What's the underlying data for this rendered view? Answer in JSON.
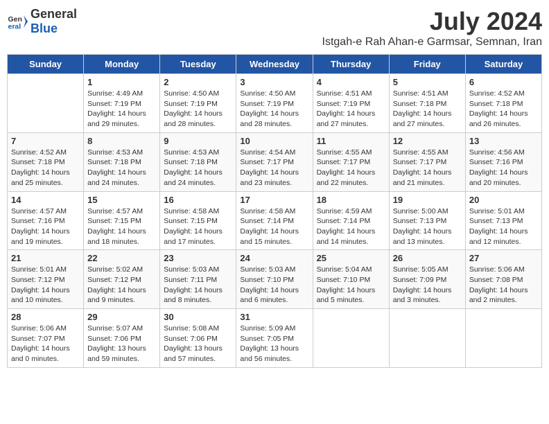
{
  "header": {
    "logo_general": "General",
    "logo_blue": "Blue",
    "month_year": "July 2024",
    "location": "Istgah-e Rah Ahan-e Garmsar, Semnan, Iran"
  },
  "weekdays": [
    "Sunday",
    "Monday",
    "Tuesday",
    "Wednesday",
    "Thursday",
    "Friday",
    "Saturday"
  ],
  "weeks": [
    [
      {
        "day": "",
        "info": ""
      },
      {
        "day": "1",
        "info": "Sunrise: 4:49 AM\nSunset: 7:19 PM\nDaylight: 14 hours\nand 29 minutes."
      },
      {
        "day": "2",
        "info": "Sunrise: 4:50 AM\nSunset: 7:19 PM\nDaylight: 14 hours\nand 28 minutes."
      },
      {
        "day": "3",
        "info": "Sunrise: 4:50 AM\nSunset: 7:19 PM\nDaylight: 14 hours\nand 28 minutes."
      },
      {
        "day": "4",
        "info": "Sunrise: 4:51 AM\nSunset: 7:19 PM\nDaylight: 14 hours\nand 27 minutes."
      },
      {
        "day": "5",
        "info": "Sunrise: 4:51 AM\nSunset: 7:18 PM\nDaylight: 14 hours\nand 27 minutes."
      },
      {
        "day": "6",
        "info": "Sunrise: 4:52 AM\nSunset: 7:18 PM\nDaylight: 14 hours\nand 26 minutes."
      }
    ],
    [
      {
        "day": "7",
        "info": "Sunrise: 4:52 AM\nSunset: 7:18 PM\nDaylight: 14 hours\nand 25 minutes."
      },
      {
        "day": "8",
        "info": "Sunrise: 4:53 AM\nSunset: 7:18 PM\nDaylight: 14 hours\nand 24 minutes."
      },
      {
        "day": "9",
        "info": "Sunrise: 4:53 AM\nSunset: 7:18 PM\nDaylight: 14 hours\nand 24 minutes."
      },
      {
        "day": "10",
        "info": "Sunrise: 4:54 AM\nSunset: 7:17 PM\nDaylight: 14 hours\nand 23 minutes."
      },
      {
        "day": "11",
        "info": "Sunrise: 4:55 AM\nSunset: 7:17 PM\nDaylight: 14 hours\nand 22 minutes."
      },
      {
        "day": "12",
        "info": "Sunrise: 4:55 AM\nSunset: 7:17 PM\nDaylight: 14 hours\nand 21 minutes."
      },
      {
        "day": "13",
        "info": "Sunrise: 4:56 AM\nSunset: 7:16 PM\nDaylight: 14 hours\nand 20 minutes."
      }
    ],
    [
      {
        "day": "14",
        "info": "Sunrise: 4:57 AM\nSunset: 7:16 PM\nDaylight: 14 hours\nand 19 minutes."
      },
      {
        "day": "15",
        "info": "Sunrise: 4:57 AM\nSunset: 7:15 PM\nDaylight: 14 hours\nand 18 minutes."
      },
      {
        "day": "16",
        "info": "Sunrise: 4:58 AM\nSunset: 7:15 PM\nDaylight: 14 hours\nand 17 minutes."
      },
      {
        "day": "17",
        "info": "Sunrise: 4:58 AM\nSunset: 7:14 PM\nDaylight: 14 hours\nand 15 minutes."
      },
      {
        "day": "18",
        "info": "Sunrise: 4:59 AM\nSunset: 7:14 PM\nDaylight: 14 hours\nand 14 minutes."
      },
      {
        "day": "19",
        "info": "Sunrise: 5:00 AM\nSunset: 7:13 PM\nDaylight: 14 hours\nand 13 minutes."
      },
      {
        "day": "20",
        "info": "Sunrise: 5:01 AM\nSunset: 7:13 PM\nDaylight: 14 hours\nand 12 minutes."
      }
    ],
    [
      {
        "day": "21",
        "info": "Sunrise: 5:01 AM\nSunset: 7:12 PM\nDaylight: 14 hours\nand 10 minutes."
      },
      {
        "day": "22",
        "info": "Sunrise: 5:02 AM\nSunset: 7:12 PM\nDaylight: 14 hours\nand 9 minutes."
      },
      {
        "day": "23",
        "info": "Sunrise: 5:03 AM\nSunset: 7:11 PM\nDaylight: 14 hours\nand 8 minutes."
      },
      {
        "day": "24",
        "info": "Sunrise: 5:03 AM\nSunset: 7:10 PM\nDaylight: 14 hours\nand 6 minutes."
      },
      {
        "day": "25",
        "info": "Sunrise: 5:04 AM\nSunset: 7:10 PM\nDaylight: 14 hours\nand 5 minutes."
      },
      {
        "day": "26",
        "info": "Sunrise: 5:05 AM\nSunset: 7:09 PM\nDaylight: 14 hours\nand 3 minutes."
      },
      {
        "day": "27",
        "info": "Sunrise: 5:06 AM\nSunset: 7:08 PM\nDaylight: 14 hours\nand 2 minutes."
      }
    ],
    [
      {
        "day": "28",
        "info": "Sunrise: 5:06 AM\nSunset: 7:07 PM\nDaylight: 14 hours\nand 0 minutes."
      },
      {
        "day": "29",
        "info": "Sunrise: 5:07 AM\nSunset: 7:06 PM\nDaylight: 13 hours\nand 59 minutes."
      },
      {
        "day": "30",
        "info": "Sunrise: 5:08 AM\nSunset: 7:06 PM\nDaylight: 13 hours\nand 57 minutes."
      },
      {
        "day": "31",
        "info": "Sunrise: 5:09 AM\nSunset: 7:05 PM\nDaylight: 13 hours\nand 56 minutes."
      },
      {
        "day": "",
        "info": ""
      },
      {
        "day": "",
        "info": ""
      },
      {
        "day": "",
        "info": ""
      }
    ]
  ]
}
